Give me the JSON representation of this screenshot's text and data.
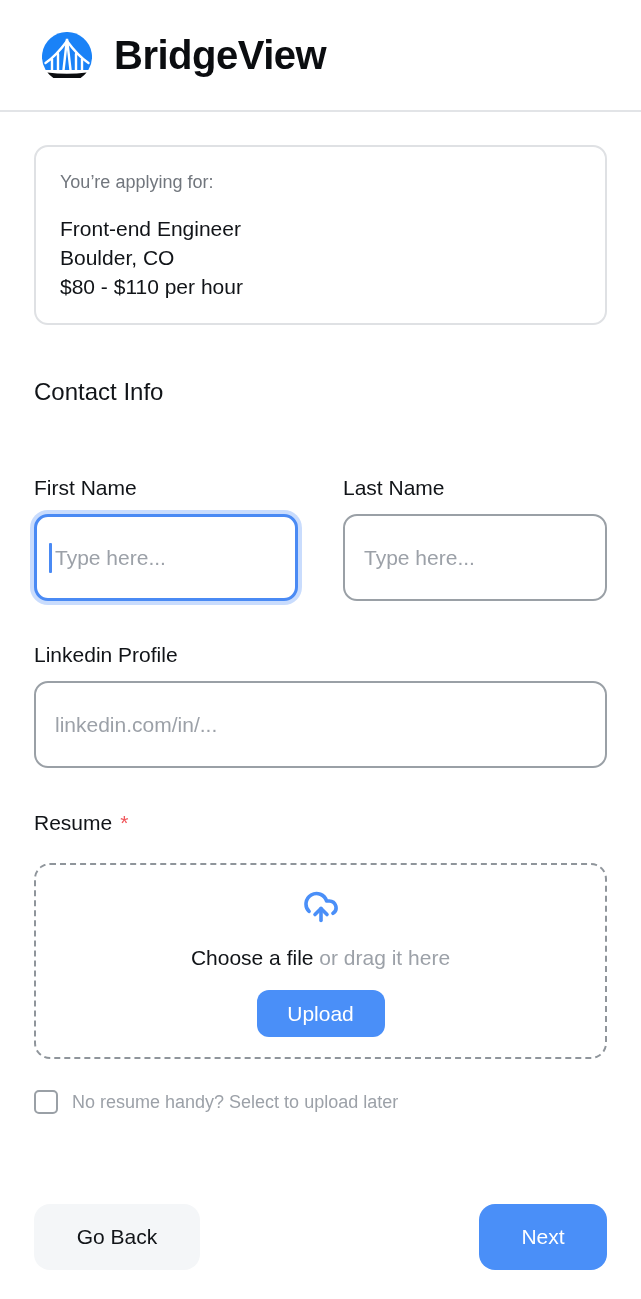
{
  "header": {
    "brand": "BridgeView"
  },
  "job": {
    "caption": "You’re applying for:",
    "title": "Front-end Engineer",
    "location": "Boulder, CO",
    "pay": "$80 - $110 per hour"
  },
  "section_title": "Contact Info",
  "name_row": [
    {
      "label": "First Name",
      "placeholder": "Type here...",
      "focused": true
    },
    {
      "label": "Last Name",
      "placeholder": "Type here...",
      "focused": false
    }
  ],
  "linkedin_field": {
    "label": "Linkedin Profile",
    "placeholder": "linkedin.com/in/...",
    "focused": false
  },
  "resume": {
    "label": "Resume",
    "required_mark": "*",
    "prompt": "Choose a file",
    "prompt_hint": "or drag it here",
    "button": "Upload",
    "later_option": {
      "label": "No resume handy? Select to upload later",
      "checked": false
    }
  },
  "actions": [
    {
      "label": "Go Back",
      "kind": "secondary"
    },
    {
      "label": "Next",
      "kind": "primary"
    }
  ]
}
